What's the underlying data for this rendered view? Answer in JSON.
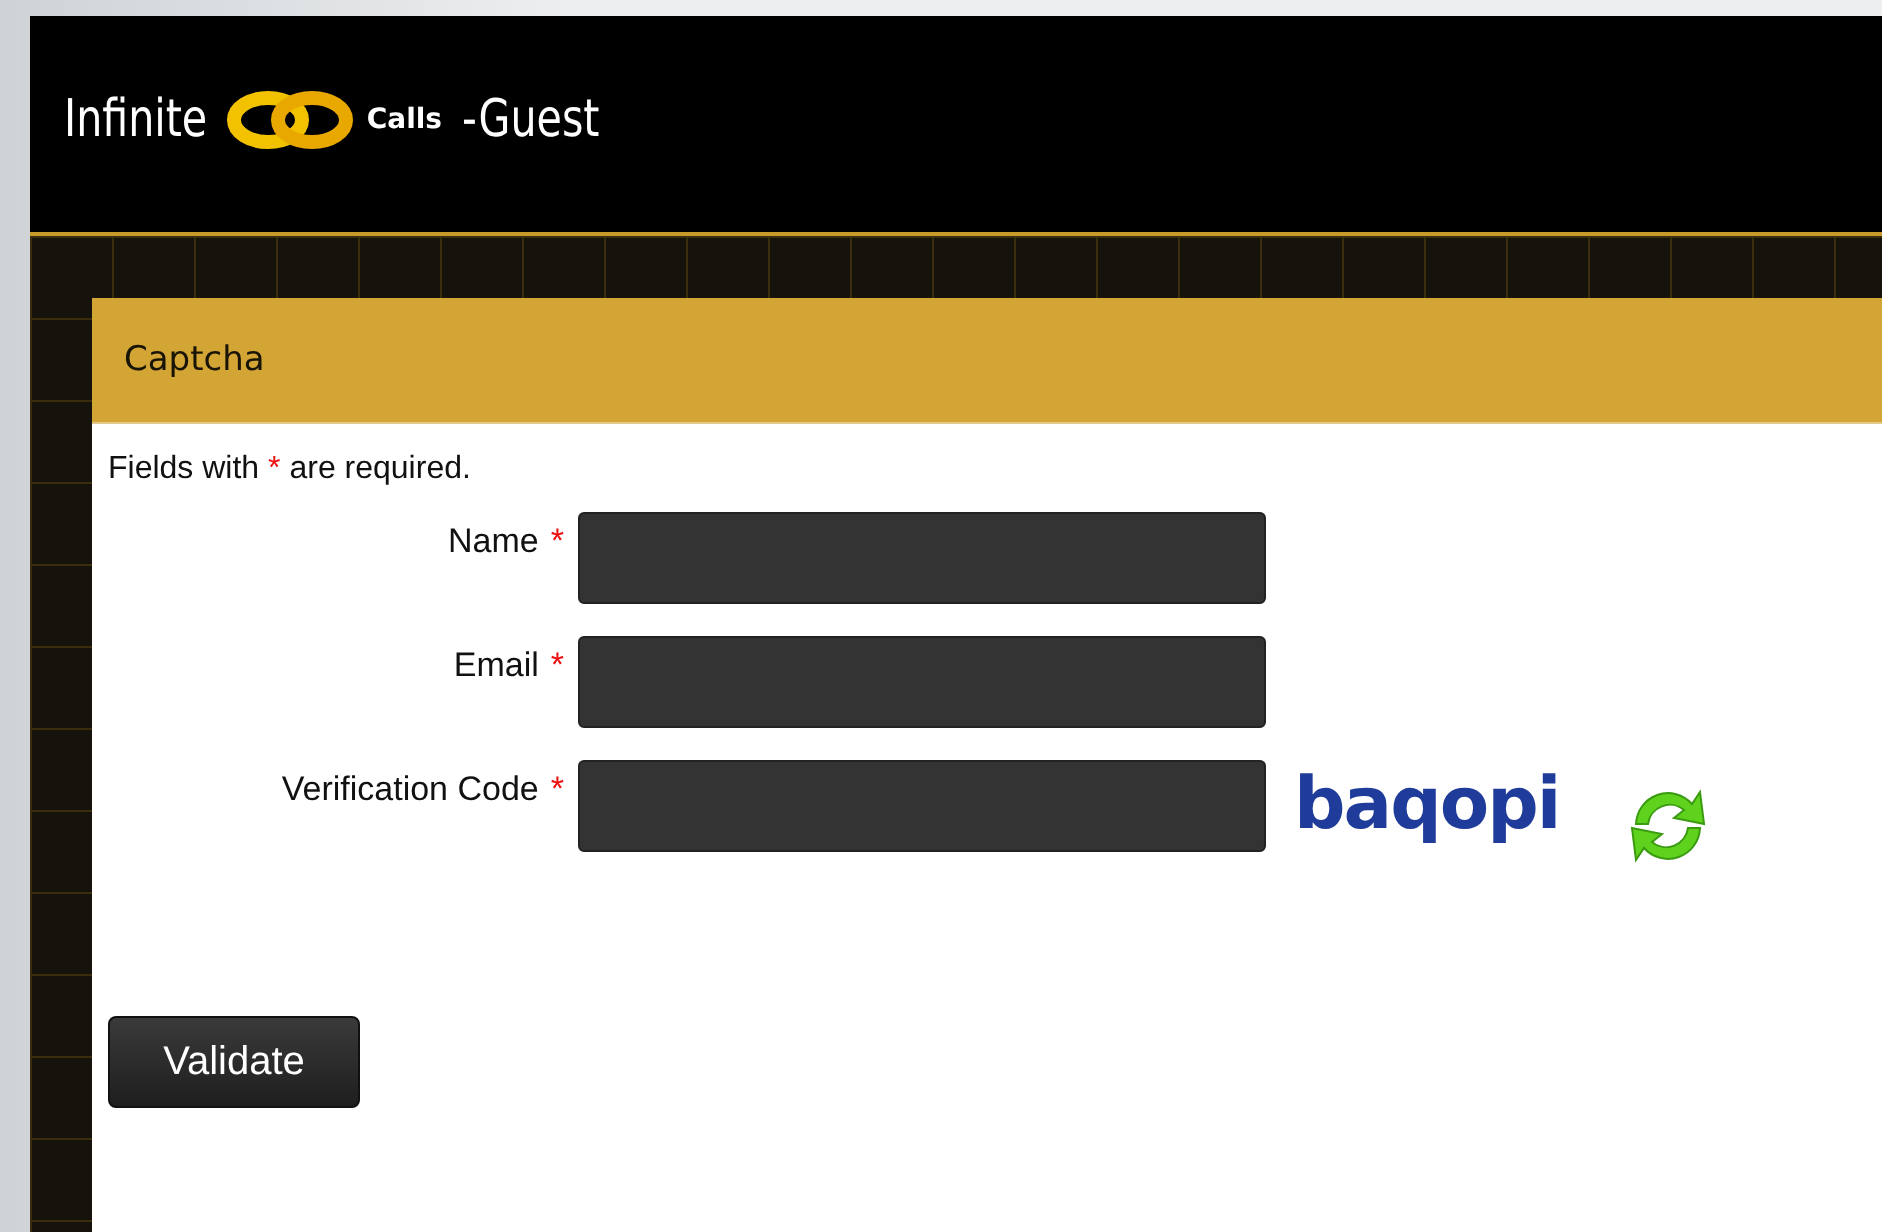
{
  "header": {
    "brand_left": "Infinite",
    "brand_right": "Calls",
    "suffix": "-Guest"
  },
  "panel": {
    "title": "Captcha",
    "note_parts": [
      "Fields with ",
      "*",
      " are required."
    ],
    "fields": [
      {
        "label": "Name",
        "required": true,
        "kind": "text"
      },
      {
        "label": "Email",
        "required": true,
        "kind": "text"
      },
      {
        "label": "Verification Code",
        "required": true,
        "kind": "captcha",
        "captcha": "baqopi"
      }
    ],
    "submit": "Validate"
  }
}
